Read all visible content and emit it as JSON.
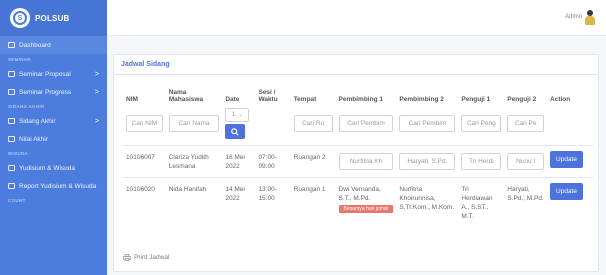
{
  "brand": {
    "name": "POLSUB"
  },
  "sidebar": {
    "items": [
      {
        "type": "item",
        "label": "Dashboard",
        "icon": "dashboard-icon",
        "chevron": ""
      },
      {
        "type": "head",
        "label": "SEMINAR"
      },
      {
        "type": "item",
        "label": "Seminar Proposal",
        "icon": "list-icon",
        "chevron": ">"
      },
      {
        "type": "item",
        "label": "Seminar Progress",
        "icon": "chart-icon",
        "chevron": ">"
      },
      {
        "type": "head",
        "label": "SIDANG AKHIR"
      },
      {
        "type": "item",
        "label": "Sidang Akhir",
        "icon": "user-icon",
        "chevron": ">"
      },
      {
        "type": "item",
        "label": "Nilai Akhir",
        "icon": "table-icon",
        "chevron": ""
      },
      {
        "type": "head",
        "label": "WISUDA"
      },
      {
        "type": "item",
        "label": "Yudisium & Wisuda",
        "icon": "table-icon",
        "chevron": ""
      },
      {
        "type": "item",
        "label": "Report Yudisium & Wisuda",
        "icon": "table-icon",
        "chevron": ""
      },
      {
        "type": "head",
        "label": "COUNT"
      }
    ]
  },
  "topbar": {
    "user": "Admin"
  },
  "card": {
    "title": "Jadwal Sidang",
    "print_label": "Print Jadwal"
  },
  "table": {
    "headers": [
      "NIM",
      "Nama Mahasiswa",
      "Date",
      "Sesi / Waktu",
      "Tempat",
      "Pembimbing 1",
      "Pembimbing 2",
      "Penguji 1",
      "Penguji 2",
      "Action"
    ],
    "filters": {
      "nim": "Cari NIM",
      "nama": "Cari Nama",
      "date": "1",
      "tempat": "Cari Ru",
      "pembimbing1": "Cari Pembim",
      "pembimbing2": "Cari Pembim",
      "penguji1": "Cari Peng",
      "penguji2": "Cari Pe"
    },
    "rows": [
      {
        "nim": "10106007",
        "nama": "Clariza Yudith Lesmana",
        "date": "16 Mei 2022",
        "sesi": "07:00-09:00",
        "tempat": "Ruangan 2",
        "pembimbing1": "Nurfitria Kh",
        "pembimbing2": "Haryati, S.Pd.",
        "penguji1": "Tri Herdi",
        "penguji2": "Nunu I",
        "badge": "",
        "action": "Update"
      },
      {
        "nim": "10106020",
        "nama": "Nida Hanifah",
        "date": "14 Mei 2022",
        "sesi": "13:00-15:00",
        "tempat": "Ruangan 1",
        "pembimbing1": "Dwi Vernanda, S.T., M.Pd.",
        "pembimbing2": "Nurfitria Khoirunnisa, S.Tr.Kom., M.Kom.",
        "penguji1": "Tri Herdiawan A., S.ST., M.T.",
        "penguji2": "Haryati, S.Pd., M.Pd.",
        "badge": "Besarnya hari jumat",
        "action": "Update"
      }
    ]
  },
  "colors": {
    "sidebar": "#4c7dde",
    "primary": "#4e73df",
    "badge": "#e8786d"
  }
}
